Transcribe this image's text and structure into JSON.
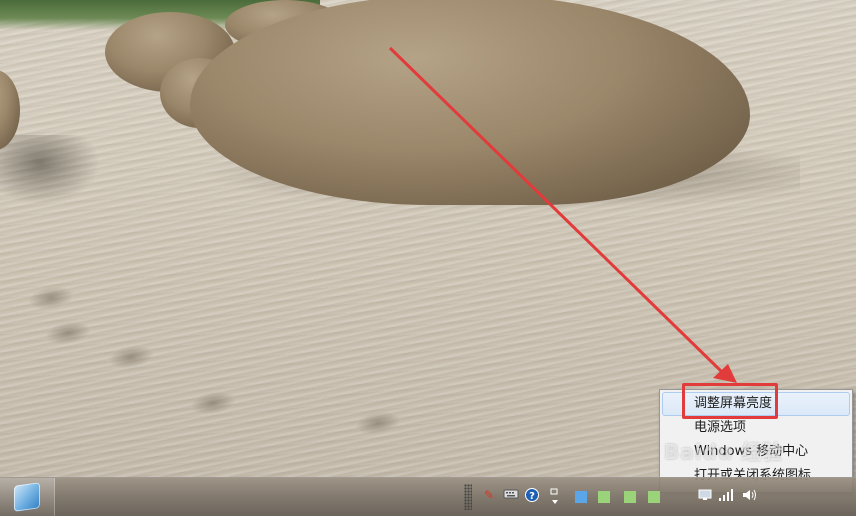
{
  "context_menu": {
    "items": [
      {
        "label": "调整屏幕亮度",
        "hover": true
      },
      {
        "label": "电源选项",
        "hover": false
      },
      {
        "label": "Windows 移动中心",
        "hover": false
      },
      {
        "label": "打开或关闭系统图标",
        "hover": false
      }
    ]
  },
  "watermark": "Baidu 经验",
  "taskbar": {
    "start_icon": "windows-logo-icon",
    "tray_icons": [
      "pen-icon",
      "keyboard-icon",
      "help-icon",
      "show-hidden-icons-icon",
      "monitor-icon",
      "network-icon",
      "volume-icon"
    ]
  },
  "colors": {
    "highlight": "#e23b3b",
    "menu_hover": "#dbe8f7"
  }
}
